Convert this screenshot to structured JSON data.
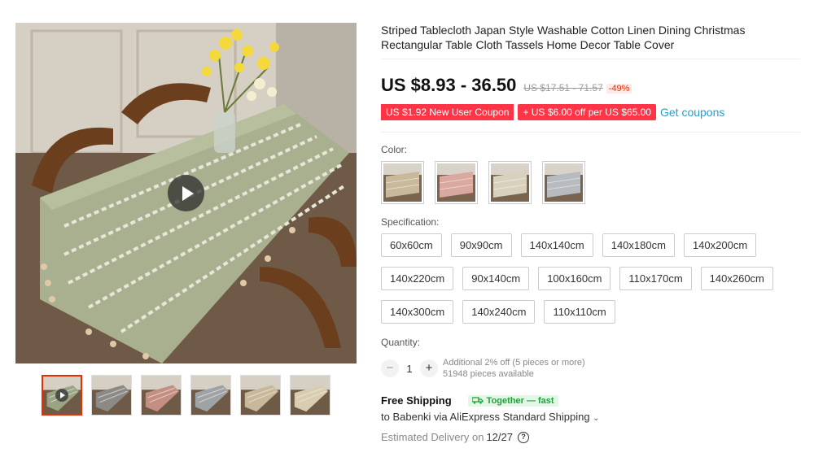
{
  "product": {
    "title": "Striped Tablecloth Japan Style Washable Cotton Linen Dining Christmas Rectangular Table Cloth Tassels Home Decor Table Cover"
  },
  "price": {
    "current": "US $8.93 - 36.50",
    "original": "US $17.51 - 71.57",
    "discount": "-49%"
  },
  "coupons": {
    "new_user": "US $1.92 New User Coupon",
    "store": "+ US $6.00 off per US $65.00",
    "get_link": "Get coupons"
  },
  "color": {
    "label": "Color:",
    "options": [
      "beige-stripe",
      "pink-stripe",
      "cream-stripe",
      "gray-stripe"
    ]
  },
  "specification": {
    "label": "Specification:",
    "options": [
      "60x60cm",
      "90x90cm",
      "140x140cm",
      "140x180cm",
      "140x200cm",
      "140x220cm",
      "90x140cm",
      "100x160cm",
      "110x170cm",
      "140x260cm",
      "140x300cm",
      "140x240cm",
      "110x110cm"
    ]
  },
  "quantity": {
    "label": "Quantity:",
    "value": "1",
    "minus": "−",
    "plus": "+",
    "note1": "Additional 2% off (5 pieces or more)",
    "note2": "51948 pieces available"
  },
  "shipping": {
    "title": "Free Shipping",
    "badge": "Together — fast",
    "detail": "to Babenki via AliExpress Standard Shipping",
    "chevron": "⌄",
    "est_label": "Estimated Delivery on",
    "est_date": "12/27",
    "help": "?"
  },
  "gallery": {
    "thumb_count": 6,
    "active_thumb": 0,
    "thumb_colors": [
      "#9aa383",
      "#8c8a86",
      "#c48f82",
      "#9fa3a6",
      "#c9b99b",
      "#d8cdb0"
    ]
  },
  "colors": {
    "accent_red": "#ff3547",
    "link_blue": "#2e9cc3",
    "green_badge": "#1fa33a"
  }
}
